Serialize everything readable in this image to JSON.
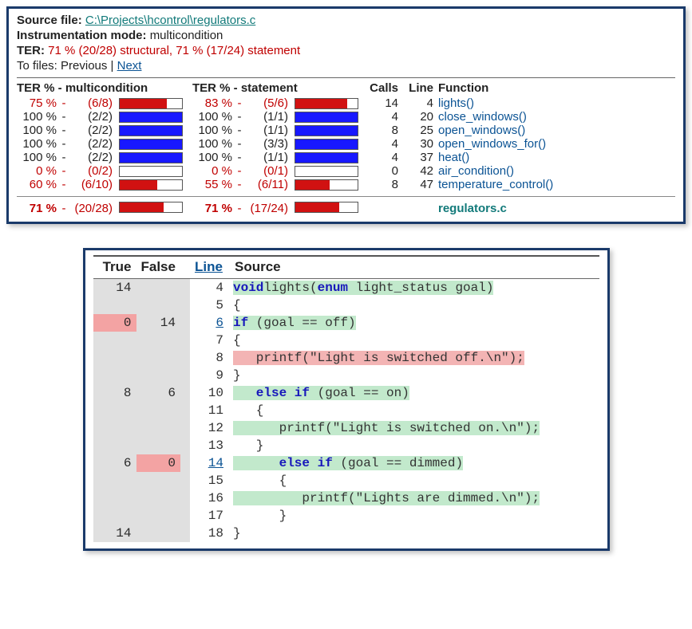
{
  "top": {
    "labels": {
      "source": "Source file:",
      "mode": "Instrumentation mode:",
      "ter": "TER:",
      "tofiles": "To files:"
    },
    "source_path": "C:\\Projects\\hcontrol\\regulators.c",
    "mode_value": "multicondition",
    "ter_value": "71 % (20/28) structural, 71 % (17/24) statement",
    "nav_prev": "Previous",
    "nav_sep": " | ",
    "nav_next": "Next"
  },
  "summary": {
    "head": {
      "mc": "TER % - multicondition",
      "st": "TER % - statement",
      "calls": "Calls",
      "line": "Line",
      "fn": "Function"
    },
    "dash": "-",
    "rows": [
      {
        "mc_pct": "75 %",
        "mc_cov": "(6/8)",
        "mc_fill": 75,
        "mc_col": "red",
        "st_pct": "83 %",
        "st_cov": "(5/6)",
        "st_fill": 83,
        "st_col": "red",
        "calls": "14",
        "line": "4",
        "fn": "lights()",
        "red": true
      },
      {
        "mc_pct": "100 %",
        "mc_cov": "(2/2)",
        "mc_fill": 100,
        "mc_col": "blue",
        "st_pct": "100 %",
        "st_cov": "(1/1)",
        "st_fill": 100,
        "st_col": "blue",
        "calls": "4",
        "line": "20",
        "fn": "close_windows()",
        "red": false
      },
      {
        "mc_pct": "100 %",
        "mc_cov": "(2/2)",
        "mc_fill": 100,
        "mc_col": "blue",
        "st_pct": "100 %",
        "st_cov": "(1/1)",
        "st_fill": 100,
        "st_col": "blue",
        "calls": "8",
        "line": "25",
        "fn": "open_windows()",
        "red": false
      },
      {
        "mc_pct": "100 %",
        "mc_cov": "(2/2)",
        "mc_fill": 100,
        "mc_col": "blue",
        "st_pct": "100 %",
        "st_cov": "(3/3)",
        "st_fill": 100,
        "st_col": "blue",
        "calls": "4",
        "line": "30",
        "fn": "open_windows_for()",
        "red": false
      },
      {
        "mc_pct": "100 %",
        "mc_cov": "(2/2)",
        "mc_fill": 100,
        "mc_col": "blue",
        "st_pct": "100 %",
        "st_cov": "(1/1)",
        "st_fill": 100,
        "st_col": "blue",
        "calls": "4",
        "line": "37",
        "fn": "heat()",
        "red": false
      },
      {
        "mc_pct": "0 %",
        "mc_cov": "(0/2)",
        "mc_fill": 0,
        "mc_col": "red",
        "st_pct": "0 %",
        "st_cov": "(0/1)",
        "st_fill": 0,
        "st_col": "red",
        "calls": "0",
        "line": "42",
        "fn": "air_condition()",
        "red": true
      },
      {
        "mc_pct": "60 %",
        "mc_cov": "(6/10)",
        "mc_fill": 60,
        "mc_col": "red",
        "st_pct": "55 %",
        "st_cov": "(6/11)",
        "st_fill": 55,
        "st_col": "red",
        "calls": "8",
        "line": "47",
        "fn": "temperature_control()",
        "red": true
      }
    ],
    "total": {
      "mc_pct": "71 %",
      "mc_cov": "(20/28)",
      "mc_fill": 71,
      "st_pct": "71 %",
      "st_cov": "(17/24)",
      "st_fill": 71,
      "file": "regulators.c"
    }
  },
  "source_panel": {
    "head": {
      "true": "True",
      "false": "False",
      "line": "Line",
      "source": "Source"
    },
    "lines": [
      {
        "t": "14",
        "f": "",
        "tpk": false,
        "fpk": false,
        "ln": "4",
        "ln_link": false,
        "hl": "gr",
        "segs": [
          [
            "kw",
            "void"
          ],
          [
            "",
            ""
          ],
          [
            "",
            "lights("
          ],
          [
            "kw",
            "enum"
          ],
          [
            "",
            " light_status goal)"
          ]
        ]
      },
      {
        "t": "",
        "f": "",
        "tpk": false,
        "fpk": false,
        "ln": "5",
        "ln_link": false,
        "hl": "",
        "segs": [
          [
            "",
            "{"
          ]
        ]
      },
      {
        "t": "0",
        "f": "14",
        "tpk": true,
        "fpk": false,
        "ln": "6",
        "ln_link": true,
        "hl": "gr",
        "segs": [
          [
            "kw",
            "if"
          ],
          [
            "",
            " (goal == off)"
          ]
        ]
      },
      {
        "t": "",
        "f": "",
        "tpk": false,
        "fpk": false,
        "ln": "7",
        "ln_link": false,
        "hl": "",
        "segs": [
          [
            "",
            "{"
          ]
        ]
      },
      {
        "t": "",
        "f": "",
        "tpk": false,
        "fpk": false,
        "ln": "8",
        "ln_link": false,
        "hl": "pk",
        "segs": [
          [
            "",
            "   printf(\"Light is switched off.\\n\");"
          ]
        ]
      },
      {
        "t": "",
        "f": "",
        "tpk": false,
        "fpk": false,
        "ln": "9",
        "ln_link": false,
        "hl": "",
        "segs": [
          [
            "",
            "}"
          ]
        ]
      },
      {
        "t": "8",
        "f": "6",
        "tpk": false,
        "fpk": false,
        "ln": "10",
        "ln_link": false,
        "hl": "gr",
        "segs": [
          [
            "",
            "   "
          ],
          [
            "kw",
            "else if"
          ],
          [
            "",
            " (goal == on)"
          ]
        ]
      },
      {
        "t": "",
        "f": "",
        "tpk": false,
        "fpk": false,
        "ln": "11",
        "ln_link": false,
        "hl": "",
        "segs": [
          [
            "",
            "   {"
          ]
        ]
      },
      {
        "t": "",
        "f": "",
        "tpk": false,
        "fpk": false,
        "ln": "12",
        "ln_link": false,
        "hl": "gr",
        "segs": [
          [
            "",
            "      printf(\"Light is switched on.\\n\");"
          ]
        ]
      },
      {
        "t": "",
        "f": "",
        "tpk": false,
        "fpk": false,
        "ln": "13",
        "ln_link": false,
        "hl": "",
        "segs": [
          [
            "",
            "   }"
          ]
        ]
      },
      {
        "t": "6",
        "f": "0",
        "tpk": false,
        "fpk": true,
        "ln": "14",
        "ln_link": true,
        "hl": "gr",
        "segs": [
          [
            "",
            "      "
          ],
          [
            "kw",
            "else if"
          ],
          [
            "",
            " (goal == dimmed)"
          ]
        ]
      },
      {
        "t": "",
        "f": "",
        "tpk": false,
        "fpk": false,
        "ln": "15",
        "ln_link": false,
        "hl": "",
        "segs": [
          [
            "",
            "      {"
          ]
        ]
      },
      {
        "t": "",
        "f": "",
        "tpk": false,
        "fpk": false,
        "ln": "16",
        "ln_link": false,
        "hl": "gr",
        "segs": [
          [
            "",
            "         printf(\"Lights are dimmed.\\n\");"
          ]
        ]
      },
      {
        "t": "",
        "f": "",
        "tpk": false,
        "fpk": false,
        "ln": "17",
        "ln_link": false,
        "hl": "",
        "segs": [
          [
            "",
            "      }"
          ]
        ]
      },
      {
        "t": "14",
        "f": "",
        "tpk": false,
        "fpk": false,
        "ln": "18",
        "ln_link": false,
        "hl": "",
        "segs": [
          [
            "",
            "}"
          ]
        ]
      }
    ]
  }
}
